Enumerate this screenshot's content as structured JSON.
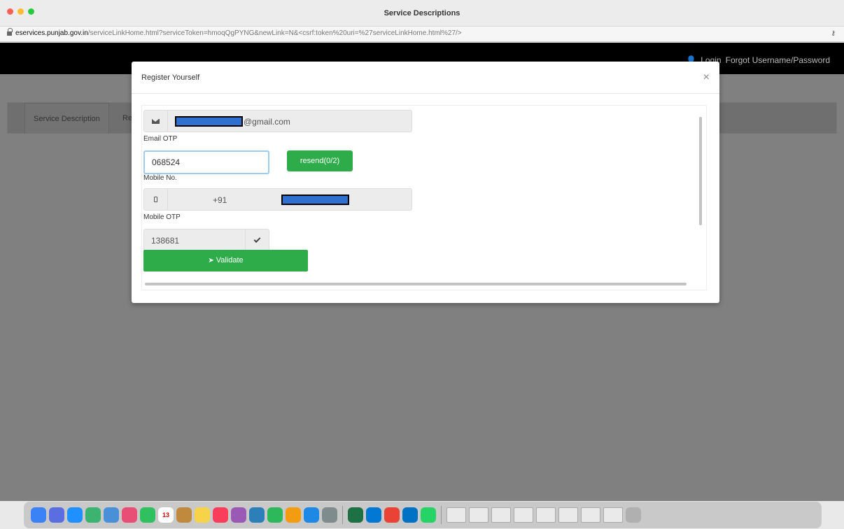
{
  "window": {
    "title": "Service Descriptions"
  },
  "addressbar": {
    "domain": "eservices.punjab.gov.in",
    "path": "/serviceLinkHome.html?serviceToken=hmoqQgPYNG&newLink=N&<csrf:token%20uri=%27serviceLinkHome.html%27/>"
  },
  "nav": {
    "login": "Login",
    "forgot": "Forgot Username/Password"
  },
  "tabs": {
    "service_description": "Service Description",
    "second_tab_partial": "Re"
  },
  "modal": {
    "title": "Register Yourself",
    "close": "×",
    "email_suffix": "@gmail.com",
    "email_otp_label": "Email OTP",
    "email_otp_value": "068524",
    "resend_label": "resend(0/2)",
    "mobile_label": "Mobile No.",
    "country_code": "+91",
    "mobile_otp_label": "Mobile OTP",
    "mobile_otp_value": "138681",
    "validate_label": "Validate"
  },
  "dock": {
    "calendar_day": "13"
  },
  "icons": {
    "email": "envelope-icon",
    "mobile": "mobile-icon",
    "check": "check-icon",
    "validate": "send-arrow-icon",
    "close": "close-icon"
  },
  "colors": {
    "accent_green": "#2eac49",
    "redaction_blue": "#2f6fd0",
    "nav_black": "#000000"
  }
}
